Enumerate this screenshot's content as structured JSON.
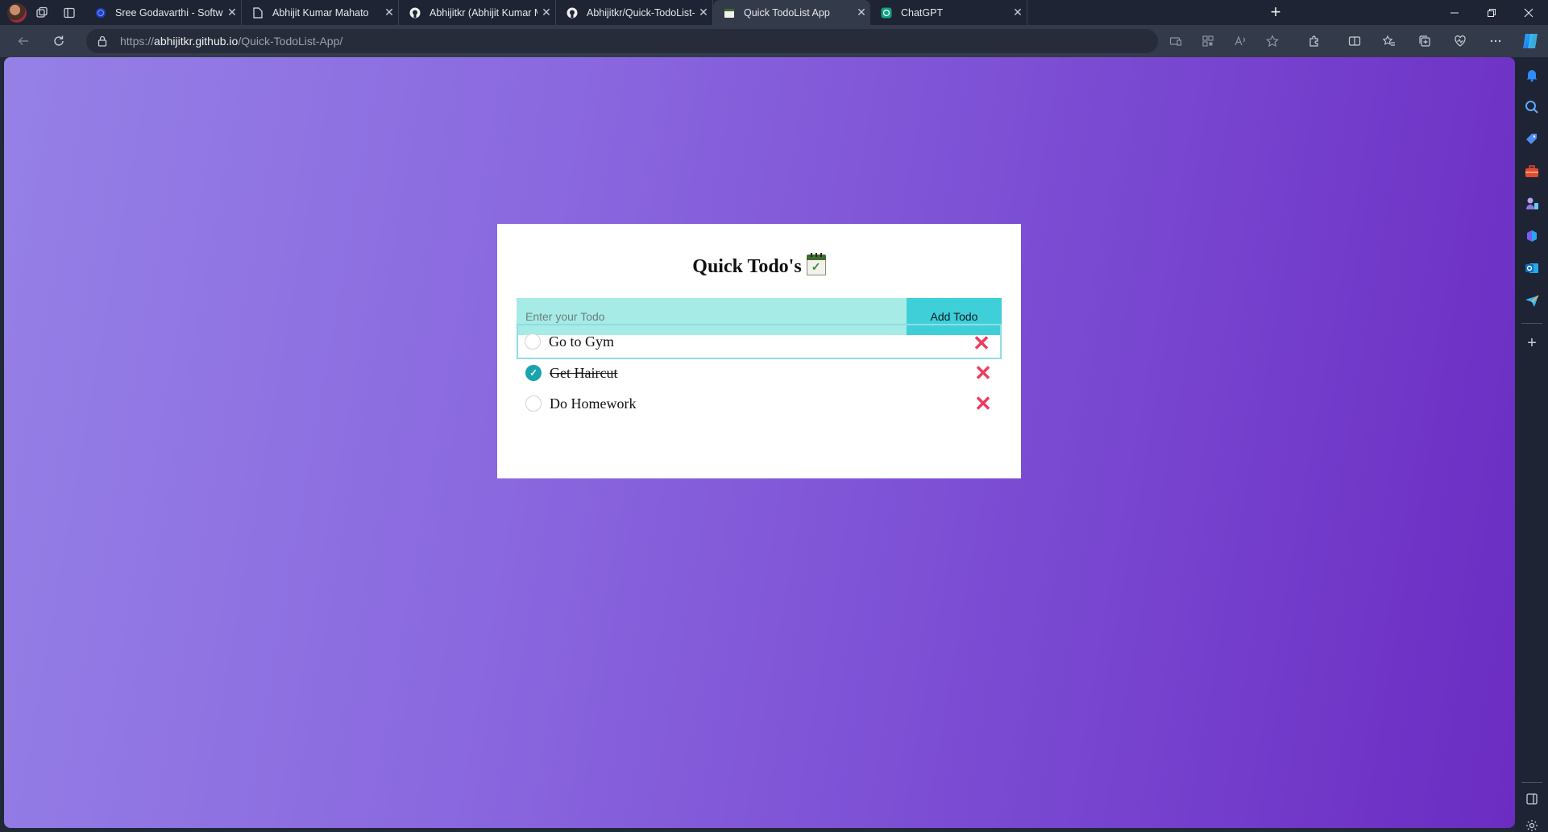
{
  "browser": {
    "tabs": [
      {
        "title": "Sree Godavarthi - Software Engi",
        "favicon": "globe-icon"
      },
      {
        "title": "Abhijit Kumar Mahato",
        "favicon": "document-icon"
      },
      {
        "title": "Abhijitkr (Abhijit Kumar Mahato)",
        "favicon": "github-icon"
      },
      {
        "title": "Abhijitkr/Quick-TodoList-App: Th",
        "favicon": "github-icon"
      },
      {
        "title": "Quick TodoList App",
        "favicon": "page-icon",
        "active": true
      },
      {
        "title": "ChatGPT",
        "favicon": "chatgpt-icon"
      }
    ],
    "url": {
      "scheme": "https://",
      "host": "abhijitkr.github.io",
      "path": "/Quick-TodoList-App/"
    }
  },
  "app": {
    "title": "Quick Todo's",
    "title_icon": "calendar-check-icon",
    "input_placeholder": "Enter your Todo",
    "add_button_label": "Add Todo",
    "todos": [
      {
        "text": "Go to Gym",
        "done": false,
        "focused": true
      },
      {
        "text": "Get Haircut",
        "done": true,
        "focused": false
      },
      {
        "text": "Do Homework",
        "done": false,
        "focused": false
      }
    ]
  },
  "colors": {
    "gradient_start": "#9581e6",
    "gradient_end": "#6b2cc2",
    "input_bg": "#a6ebe6",
    "button_bg": "#3fcfd9",
    "check_color": "#1aa3ae",
    "delete_color": "#f03a5f"
  }
}
